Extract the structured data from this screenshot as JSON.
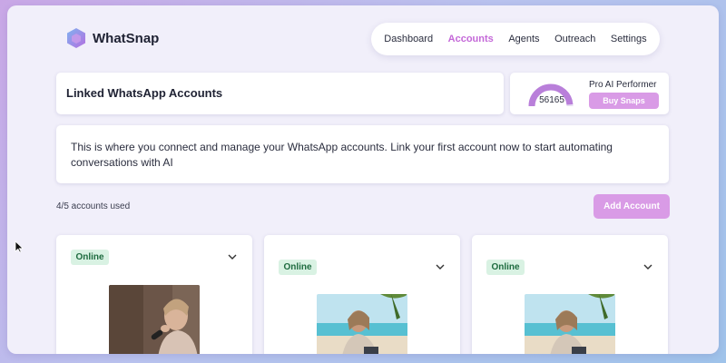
{
  "brand": {
    "name": "WhatSnap",
    "logo_icon": "hexagon-logo-icon",
    "accent_color": "#c468d8"
  },
  "nav": {
    "items": [
      {
        "label": "Dashboard",
        "active": false
      },
      {
        "label": "Accounts",
        "active": true
      },
      {
        "label": "Agents",
        "active": false
      },
      {
        "label": "Outreach",
        "active": false
      },
      {
        "label": "Settings",
        "active": false
      }
    ]
  },
  "page": {
    "title": "Linked WhatsApp Accounts"
  },
  "performance": {
    "gauge_value": "56165",
    "label": "Pro AI Performer",
    "buy_label": "Buy Snaps"
  },
  "info": {
    "text": "This is where you connect and manage your WhatsApp accounts. Link your first account now to start automating conversations with AI"
  },
  "accounts": {
    "usage": "4/5 accounts used",
    "add_label": "Add Account",
    "cards": [
      {
        "status": "Online",
        "status_color": "#d9f2e3",
        "photo": "profile-photo"
      },
      {
        "status": "Online",
        "status_color": "#d9f2e3",
        "photo": "profile-photo"
      },
      {
        "status": "Online",
        "status_color": "#d9f2e3",
        "photo": "profile-photo"
      }
    ]
  }
}
